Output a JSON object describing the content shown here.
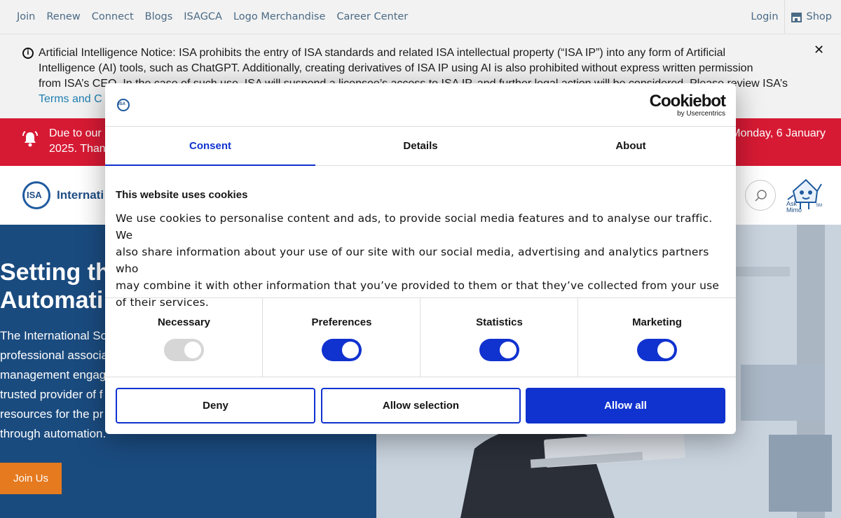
{
  "topnav": {
    "links": [
      "Join",
      "Renew",
      "Connect",
      "Blogs",
      "ISAGCA",
      "Logo Merchandise",
      "Career Center"
    ],
    "login": "Login",
    "shop": "Shop"
  },
  "notice": {
    "line1": "Artificial Intelligence Notice: ISA prohibits the entry of ISA standards and related ISA intellectual property (“ISA IP”) into any form of Artificial",
    "line2": "Intelligence (AI) tools, such as ChatGPT. Additionally, creating derivatives of ISA IP using AI is also prohibited without express written permission",
    "line3": "from ISA’s CEO. In the case of such use, ISA will suspend a licensee’s access to ISA IP, and further legal action will be considered. Please review ISA’s",
    "terms": "Terms and C",
    "close": "✕"
  },
  "alert": {
    "line1": "Due to our",
    "line2": "2025. Than",
    "right1": "Monday, 6 January"
  },
  "header": {
    "logo_text": "ISA",
    "brand": "Internati",
    "mimo_label": "Ask Mimo",
    "mimo_sm": "SM"
  },
  "hero": {
    "title1": "Setting th",
    "title2": "Automati",
    "body": [
      "The International So",
      "professional associa",
      "management engag",
      "trusted provider of f",
      "resources for the pr",
      "through automation."
    ],
    "cta": "Join Us"
  },
  "modal": {
    "logo_text": "ISA",
    "brand_main": "Cookiebot",
    "brand_sub": "by Usercentrics",
    "tabs": [
      "Consent",
      "Details",
      "About"
    ],
    "active_tab": "Consent",
    "title": "This website uses cookies",
    "text_lines": [
      "We use cookies to personalise content and ads, to provide social media features and to analyse our traffic. We",
      "also share information about your use of our site with our social media, advertising and analytics partners who",
      "may combine it with other information that you’ve provided to them or that they’ve collected from your use",
      "of their services."
    ],
    "toggles": [
      {
        "label": "Necessary",
        "checked": true,
        "disabled": true
      },
      {
        "label": "Preferences",
        "checked": true,
        "disabled": false
      },
      {
        "label": "Statistics",
        "checked": true,
        "disabled": false
      },
      {
        "label": "Marketing",
        "checked": true,
        "disabled": false
      }
    ],
    "buttons": {
      "deny": "Deny",
      "allow_selection": "Allow selection",
      "allow_all": "Allow all"
    }
  },
  "colors": {
    "accent": "#1032cf",
    "alert_red": "#d71a34",
    "hero_blue": "#1a4b7f",
    "cta_orange": "#e57a1f"
  }
}
